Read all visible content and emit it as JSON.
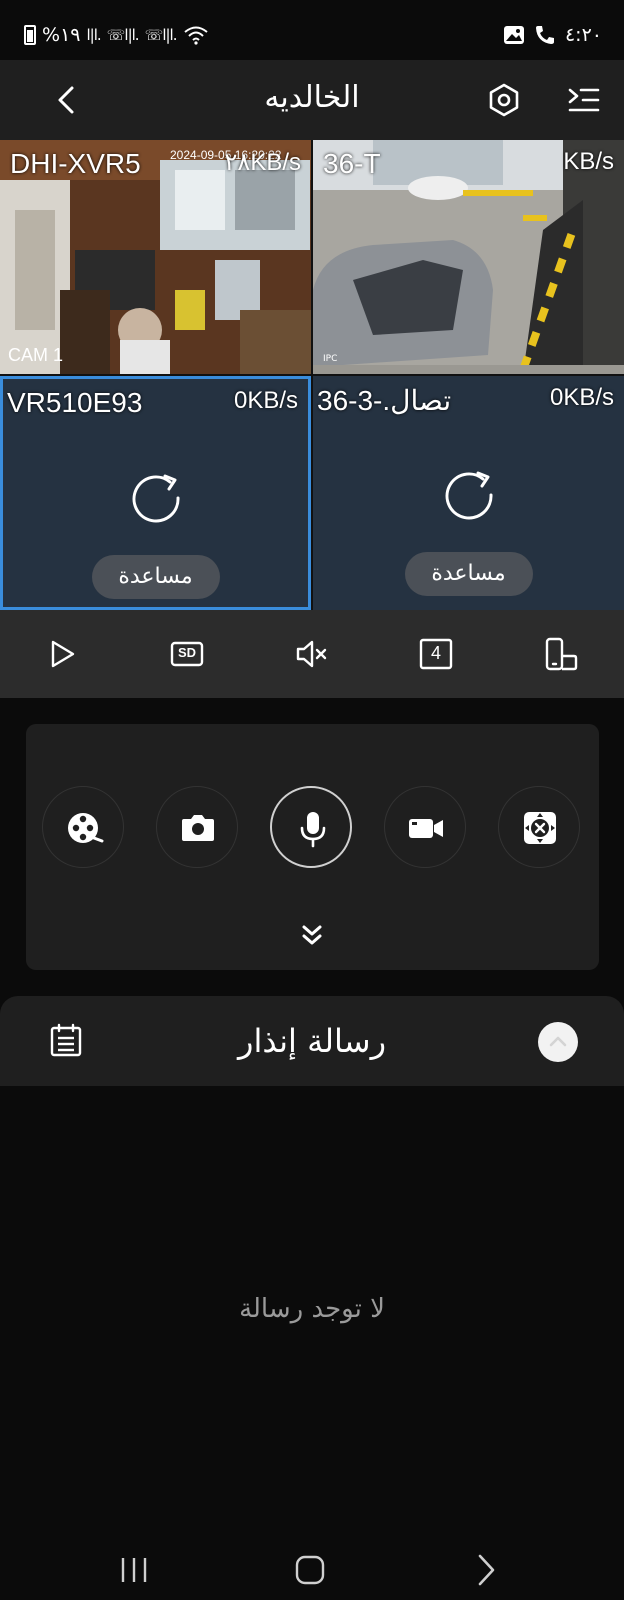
{
  "status_bar": {
    "battery_text": "%١٩",
    "time": "٤:٢٠"
  },
  "header": {
    "title": "الخالديه"
  },
  "cameras": [
    {
      "name": "DHI-XVR5",
      "speed": "٢٨KB/s",
      "timestamp": "2024-09-05 16:20:22",
      "label": "CAM 1"
    },
    {
      "name": "36-T",
      "speed": "KB/s",
      "timestamp": "",
      "label": "IPC"
    },
    {
      "name": "VR510E93",
      "speed": "0KB/s",
      "help_label": "مساعدة"
    },
    {
      "name": "36-3-.تصال",
      "speed": "0KB/s",
      "help_label": "مساعدة"
    }
  ],
  "controls": {
    "items": [
      "play-icon",
      "sd-quality-icon",
      "mute-icon",
      "grid-4-icon",
      "device-rotate-icon"
    ],
    "grid_count": "4",
    "quality": "SD"
  },
  "actions": {
    "items": [
      "film-reel-icon",
      "camera-icon",
      "microphone-icon",
      "video-record-icon",
      "ptz-icon"
    ],
    "active": "microphone-icon"
  },
  "alarm": {
    "title": "رسالة إنذار",
    "empty_text": "لا توجد رسالة"
  },
  "colors": {
    "selected_border": "#3a8ddc",
    "header_bg": "#1f1f1f",
    "tile_offline_bg": "#253241"
  }
}
